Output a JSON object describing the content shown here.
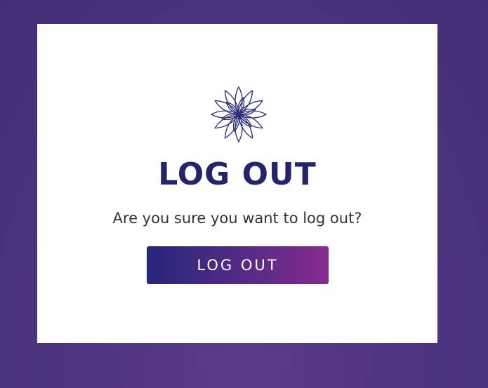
{
  "dialog": {
    "title": "LOG OUT",
    "message": "Are you sure you want to log out?",
    "confirm_label": "LOG OUT",
    "logo_icon": "lotus-flower-icon"
  },
  "colors": {
    "background": "#4a3280",
    "title": "#24246e",
    "button_gradient_start": "#26267a",
    "button_gradient_end": "#862b8e"
  }
}
